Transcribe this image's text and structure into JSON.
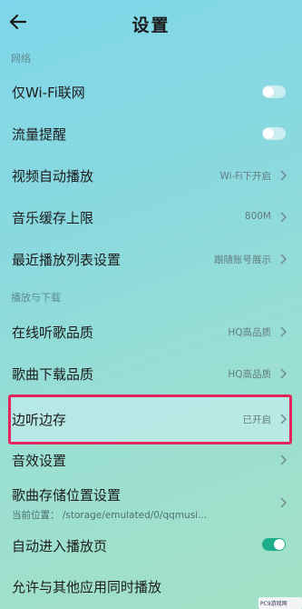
{
  "header": {
    "title": "设置"
  },
  "sections": {
    "network": "网络",
    "play_download": "播放与下载"
  },
  "rows": {
    "wifi_only": {
      "label": "仅Wi-Fi联网",
      "toggle": "off"
    },
    "traffic_alert": {
      "label": "流量提醒",
      "toggle": "off"
    },
    "video_autoplay": {
      "label": "视频自动播放",
      "value": "Wi-Fi下开启"
    },
    "cache_limit": {
      "label": "音乐缓存上限",
      "value": "800M"
    },
    "recent_playlist": {
      "label": "最近播放列表设置",
      "value": "跟随账号展示"
    },
    "online_quality": {
      "label": "在线听歌品质",
      "value": "HQ高品质"
    },
    "download_quality": {
      "label": "歌曲下载品质",
      "value": "HQ高品质"
    },
    "listen_and_save": {
      "label": "边听边存",
      "value": "已开启"
    },
    "sound_effects": {
      "label": "音效设置"
    },
    "storage_location": {
      "label": "歌曲存储位置设置",
      "subtext": "当前位置： /storage/emulated/0/qqmusi..."
    },
    "auto_enter_player": {
      "label": "自动进入播放页",
      "toggle": "on"
    },
    "allow_other_apps": {
      "label": "允许与其他应用同时播放"
    }
  },
  "watermark": "PC9游戏网",
  "colors": {
    "highlight_border": "#e4245c",
    "toggle_on": "#1dae8c"
  },
  "icons": {
    "back": "arrow-left-icon",
    "chevron": "chevron-right-icon"
  }
}
